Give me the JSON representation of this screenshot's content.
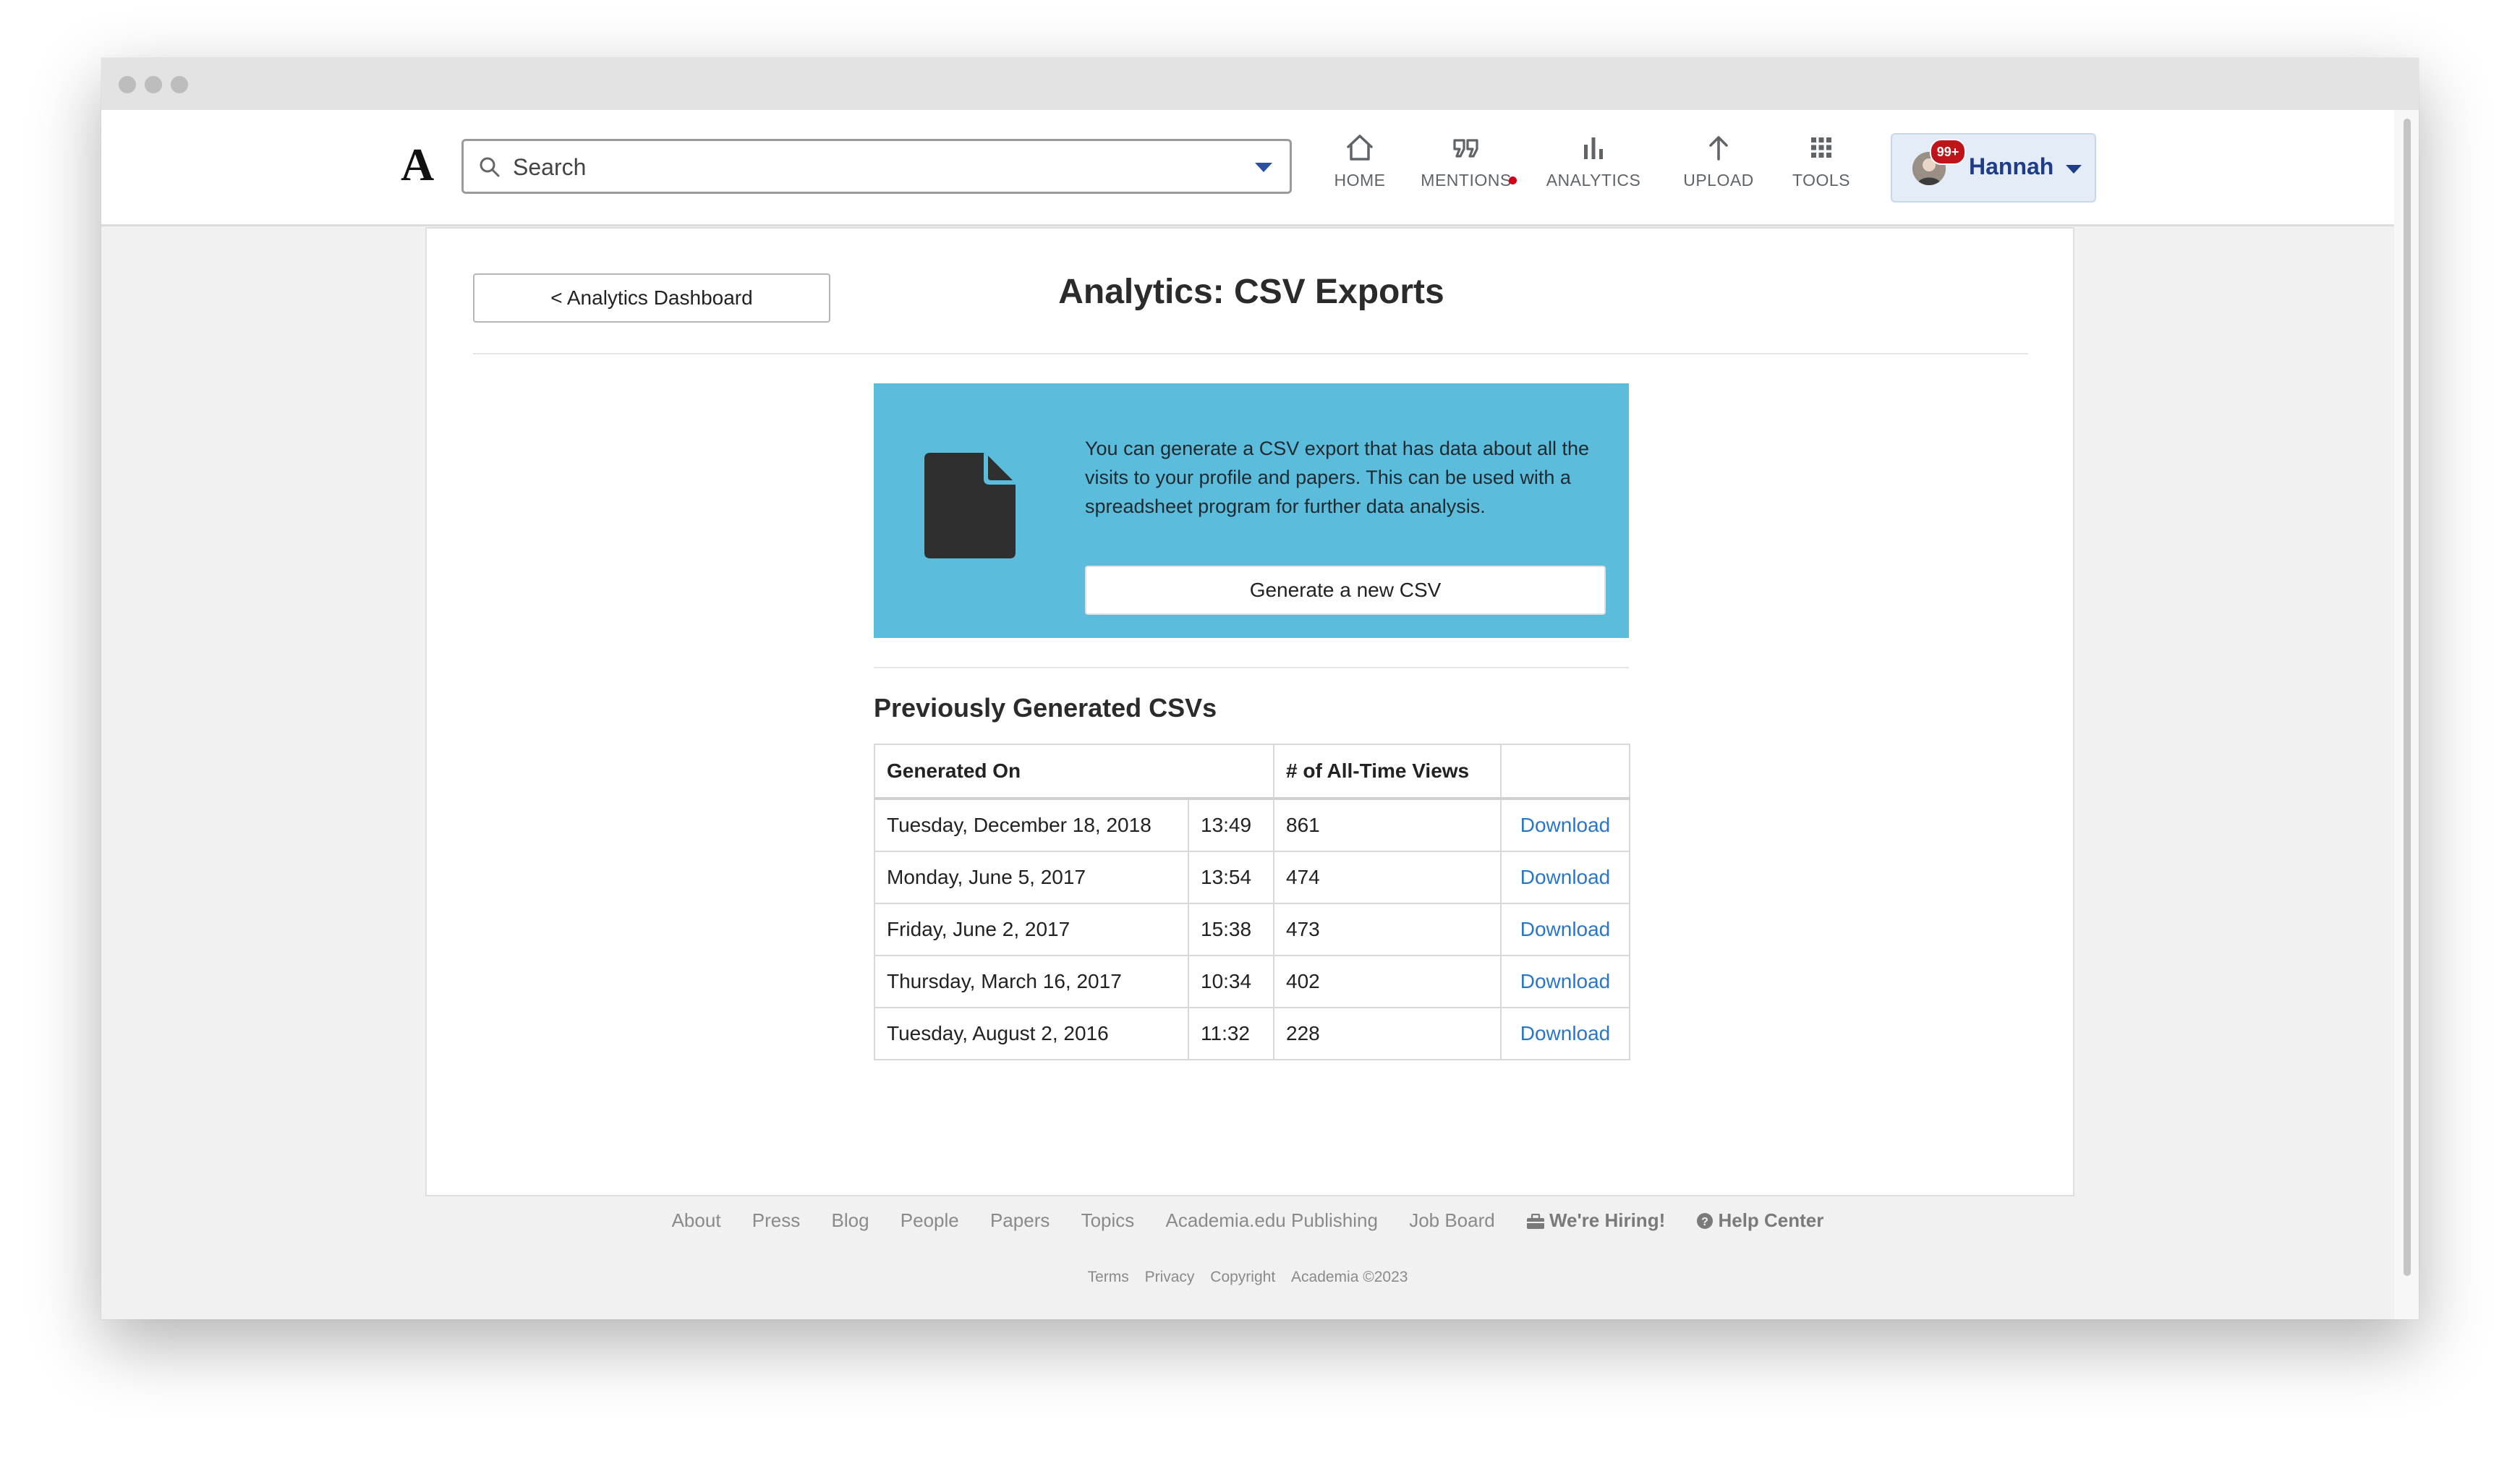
{
  "app": {
    "logo": "A"
  },
  "search": {
    "placeholder": "Search"
  },
  "nav": {
    "items": [
      {
        "label": "HOME",
        "icon": "home-icon"
      },
      {
        "label": "MENTIONS",
        "icon": "quote-icon"
      },
      {
        "label": "ANALYTICS",
        "icon": "bar-chart-icon"
      },
      {
        "label": "UPLOAD",
        "icon": "arrow-up-icon"
      },
      {
        "label": "TOOLS",
        "icon": "grid-icon"
      }
    ],
    "user": {
      "name": "Hannah",
      "badge": "99+"
    }
  },
  "page": {
    "back_label": "< Analytics Dashboard",
    "title": "Analytics: CSV Exports",
    "info_text": "You can generate a CSV export that has data about all the visits to your profile and papers. This can be used with a spreadsheet program for further data analysis.",
    "generate_label": "Generate a new CSV",
    "section_title": "Previously Generated CSVs",
    "table": {
      "headers": [
        "Generated On",
        "# of All-Time Views",
        ""
      ],
      "rows": [
        {
          "date": "Tuesday, December 18, 2018",
          "time": "13:49",
          "views": "861",
          "action": "Download"
        },
        {
          "date": "Monday, June 5, 2017",
          "time": "13:54",
          "views": "474",
          "action": "Download"
        },
        {
          "date": "Friday, June 2, 2017",
          "time": "15:38",
          "views": "473",
          "action": "Download"
        },
        {
          "date": "Thursday, March 16, 2017",
          "time": "10:34",
          "views": "402",
          "action": "Download"
        },
        {
          "date": "Tuesday, August 2, 2016",
          "time": "11:32",
          "views": "228",
          "action": "Download"
        }
      ]
    }
  },
  "footer": {
    "links": [
      "About",
      "Press",
      "Blog",
      "People",
      "Papers",
      "Topics",
      "Academia.edu Publishing",
      "Job Board"
    ],
    "hiring": "We're Hiring!",
    "help": "Help Center",
    "legal": [
      "Terms",
      "Privacy",
      "Copyright",
      "Academia ©2023"
    ]
  },
  "colors": {
    "info_box": "#5bbcdc",
    "link": "#2a76c6",
    "user_name": "#1f3c88",
    "badge": "#c0141b"
  }
}
